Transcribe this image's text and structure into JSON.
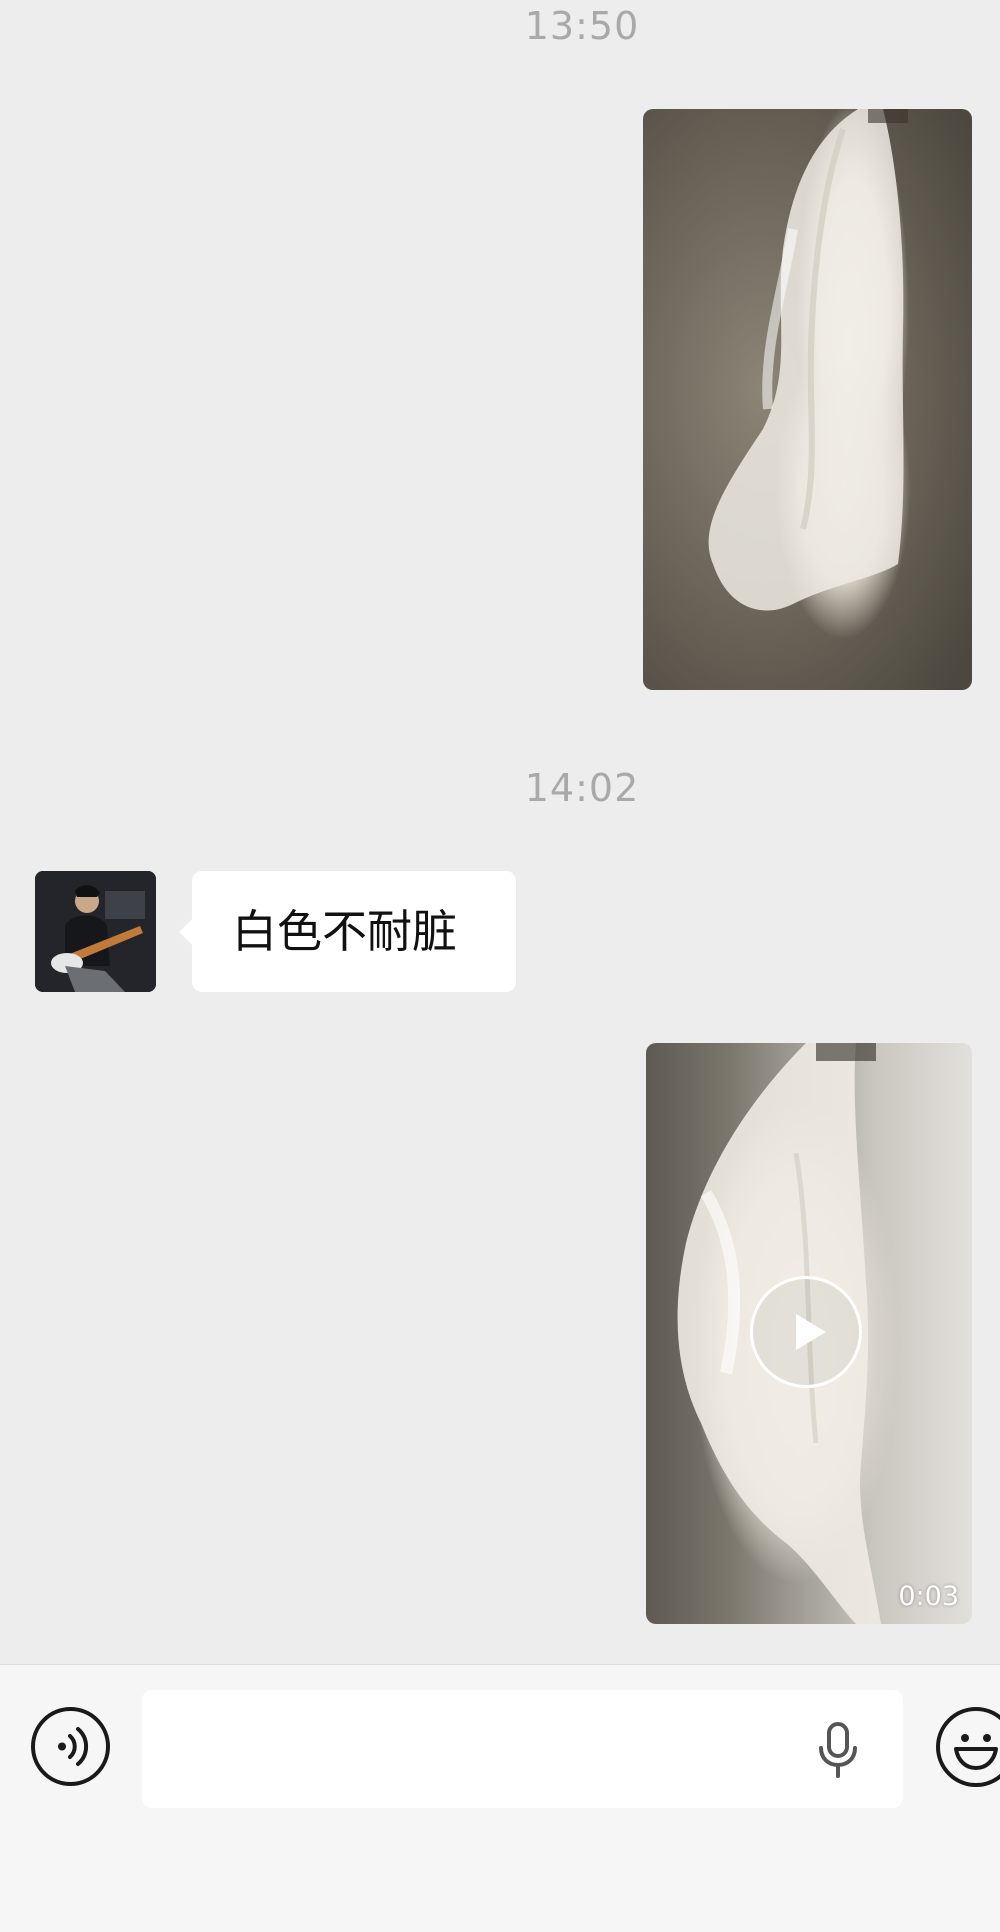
{
  "conversation": {
    "timestamps": [
      "13:50",
      "14:02"
    ],
    "messages": [
      {
        "type": "image",
        "from": "me"
      },
      {
        "type": "text",
        "from": "contact",
        "text": "白色不耐脏"
      },
      {
        "type": "video",
        "from": "me",
        "duration": "0:03"
      }
    ]
  },
  "input_bar": {
    "placeholder": "",
    "icons": [
      "voice-mode-icon",
      "microphone-icon",
      "emoji-icon"
    ]
  },
  "colors": {
    "background": "#ededed",
    "bubble_incoming": "#ffffff",
    "timestamp": "#a9a9a9",
    "input_bar": "#f6f6f6"
  }
}
